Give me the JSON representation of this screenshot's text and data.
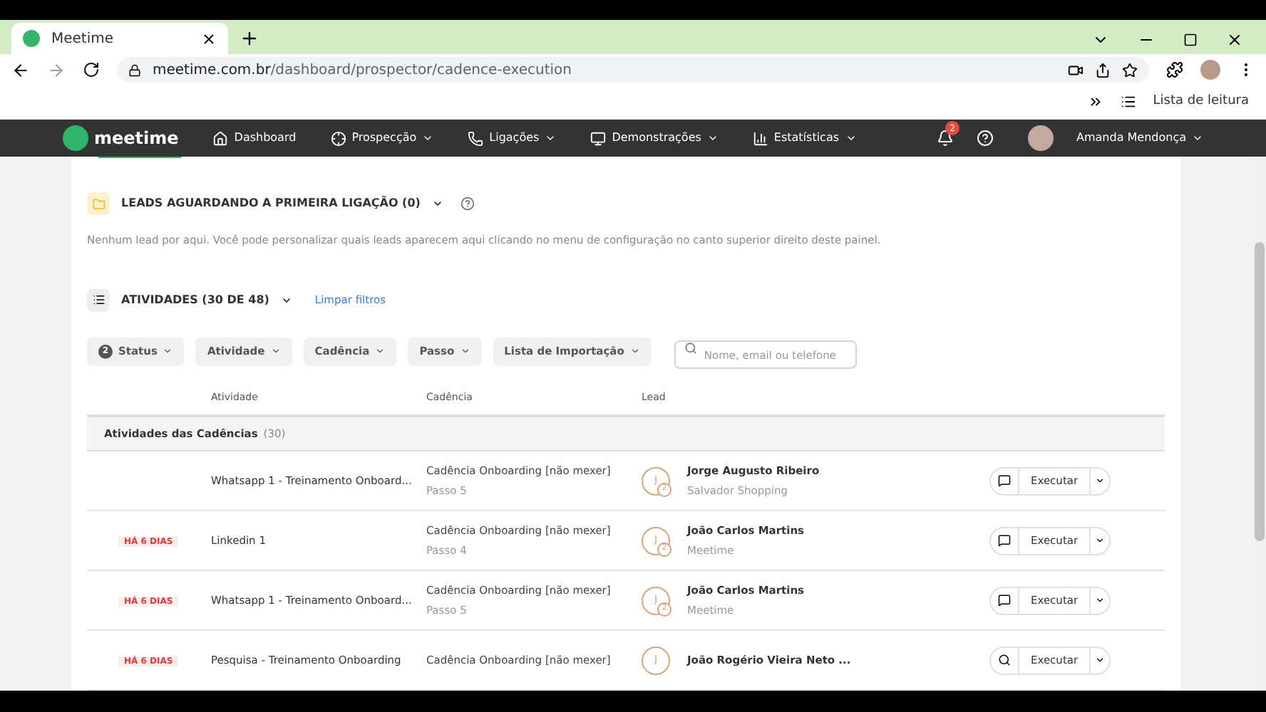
{
  "browser": {
    "tab_title": "Meetime",
    "url_host": "meetime.com.br",
    "url_path": "/dashboard/prospector/cadence-execution",
    "reading_list": "Lista de leitura"
  },
  "nav": {
    "logo": "meetime",
    "items": [
      {
        "label": "Dashboard",
        "caret": false
      },
      {
        "label": "Prospecção",
        "caret": true
      },
      {
        "label": "Ligações",
        "caret": true
      },
      {
        "label": "Demonstrações",
        "caret": true
      },
      {
        "label": "Estatísticas",
        "caret": true
      }
    ],
    "notifications": "2",
    "user": "Amanda Mendonça"
  },
  "leads_section": {
    "title": "LEADS AGUARDANDO A PRIMEIRA LIGAÇÃO (0)",
    "empty_text": "Nenhum lead por aqui. Você pode personalizar quais leads aparecem aqui clicando no menu de configuração no canto superior direito deste painel."
  },
  "activities": {
    "title": "ATIVIDADES (30 DE 48)",
    "clear_filters": "Limpar filtros",
    "filters": [
      {
        "label": "Status",
        "count": "2"
      },
      {
        "label": "Atividade"
      },
      {
        "label": "Cadência"
      },
      {
        "label": "Passo"
      },
      {
        "label": "Lista de Importação"
      }
    ],
    "search": {
      "placeholder": "Nome, email ou telefone"
    },
    "columns": [
      "Atividade",
      "Cadência",
      "Lead"
    ],
    "group": {
      "label": "Atividades das Cadências",
      "count": "(30)"
    },
    "rows": [
      {
        "overdue": null,
        "activity": "Whatsapp 1 - Treinamento Onboard...",
        "cadence": "Cadência Onboarding [não mexer]",
        "step": "Passo 5",
        "initial": "J",
        "badge": "2",
        "lead": "Jorge Augusto Ribeiro",
        "company": "Salvador Shopping",
        "kind": "message",
        "action": "Executar"
      },
      {
        "overdue": "HÁ 6 DIAS",
        "activity": "Linkedin 1",
        "cadence": "Cadência Onboarding [não mexer]",
        "step": "Passo 4",
        "initial": "J",
        "badge": "2",
        "lead": "João Carlos Martins",
        "company": "Meetime",
        "kind": "message",
        "action": "Executar"
      },
      {
        "overdue": "HÁ 6 DIAS",
        "activity": "Whatsapp 1 - Treinamento Onboard...",
        "cadence": "Cadência Onboarding [não mexer]",
        "step": "Passo 5",
        "initial": "J",
        "badge": "2",
        "lead": "João Carlos Martins",
        "company": "Meetime",
        "kind": "message",
        "action": "Executar"
      },
      {
        "overdue": "HÁ 6 DIAS",
        "activity": "Pesquisa - Treinamento Onboarding",
        "cadence": "Cadência Onboarding [não mexer]",
        "step": null,
        "initial": "J",
        "badge": null,
        "lead": "João Rogério Vieira Neto ...",
        "company": null,
        "kind": "survey",
        "action": "Executar"
      }
    ]
  }
}
